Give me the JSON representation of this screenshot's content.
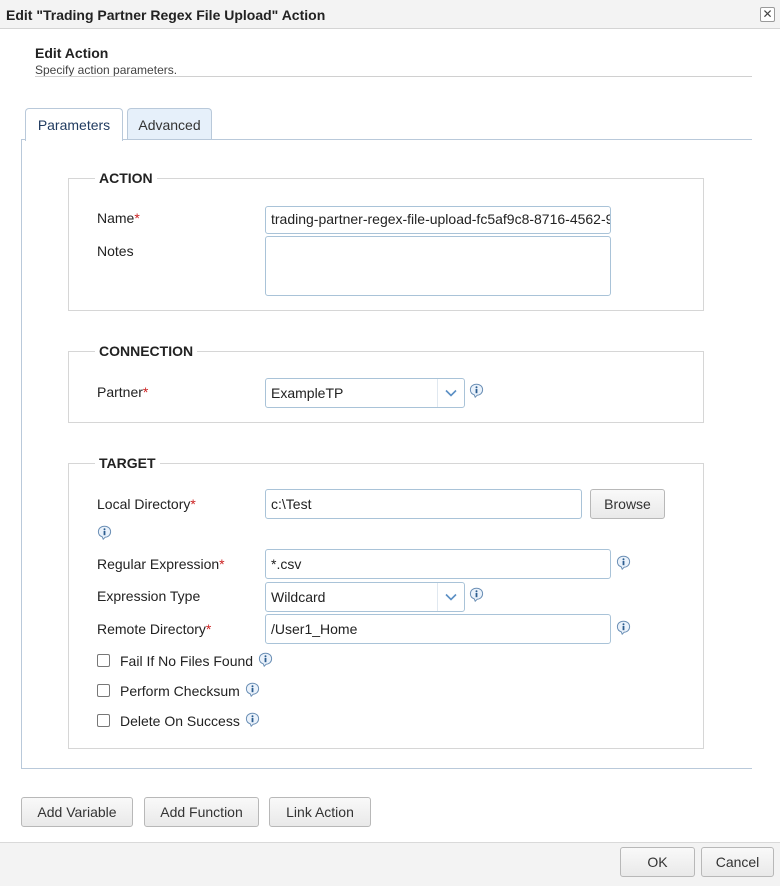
{
  "dialog": {
    "title": "Edit \"Trading Partner Regex File Upload\" Action",
    "close_glyph": "✕"
  },
  "header": {
    "title": "Edit Action",
    "subtitle": "Specify action parameters."
  },
  "tabs": [
    {
      "label": "Parameters",
      "active": true
    },
    {
      "label": "Advanced",
      "active": false
    }
  ],
  "action_section": {
    "legend": "ACTION",
    "name_label": "Name",
    "name_value": "trading-partner-regex-file-upload-fc5af9c8-8716-4562-9",
    "notes_label": "Notes",
    "notes_value": ""
  },
  "connection_section": {
    "legend": "CONNECTION",
    "partner_label": "Partner",
    "partner_value": "ExampleTP"
  },
  "target_section": {
    "legend": "TARGET",
    "local_dir_label": "Local Directory",
    "local_dir_value": "c:\\Test",
    "browse_label": "Browse",
    "regex_label": "Regular Expression",
    "regex_value": "*.csv",
    "expr_type_label": "Expression Type",
    "expr_type_value": "Wildcard",
    "remote_dir_label": "Remote Directory",
    "remote_dir_value": "/User1_Home",
    "checkboxes": [
      {
        "label": "Fail If No Files Found",
        "checked": false
      },
      {
        "label": "Perform Checksum",
        "checked": false
      },
      {
        "label": "Delete On Success",
        "checked": false
      }
    ]
  },
  "required_marker": "*",
  "bottom_buttons": {
    "add_variable": "Add Variable",
    "add_function": "Add Function",
    "link_action": "Link Action"
  },
  "footer": {
    "ok": "OK",
    "cancel": "Cancel"
  },
  "colors": {
    "accent": "#4a90d9",
    "required": "#cc2222",
    "input_border": "#a9c3d8",
    "tab_active_text": "#1f3a5f"
  },
  "icons": {
    "info": "info-icon",
    "dropdown": "chevron-down-icon",
    "close": "close-icon"
  }
}
